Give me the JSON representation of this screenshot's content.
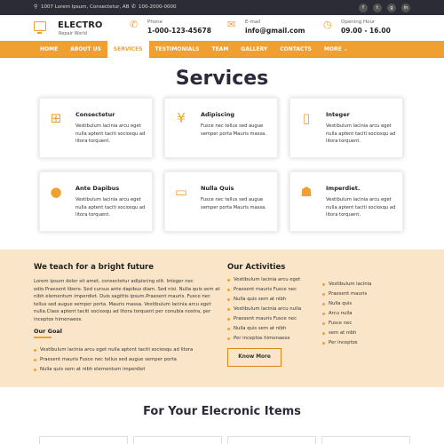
{
  "topbar": {
    "address": "1007 Lorem Ipsum, Consectetur, AB",
    "phone": "100-2000-0000",
    "socials": [
      "facebook-icon",
      "twitter-icon",
      "google-icon",
      "linkedin-icon"
    ]
  },
  "header": {
    "brand": "ELECTRO",
    "brand_sub": "Repair World",
    "phone_label": "Phone",
    "phone_value": "1-000-123-45678",
    "email_label": "E-mail",
    "email_value": "info@gmail.com",
    "hours_label": "Opening Hour",
    "hours_value": "09.00 - 16.00"
  },
  "nav": {
    "items": [
      "HOME",
      "ABOUT US",
      "SERVICES",
      "TESTIMONIALS",
      "TEAM",
      "GALLERY",
      "CONTACTS",
      "MORE ⌄"
    ],
    "active": "SERVICES"
  },
  "services": {
    "title": "Services",
    "cards": [
      {
        "icon": "windows-icon",
        "title": "Consectetur",
        "text": "Vestibulum lacinia arcu eget nulla aptent taciti sociosqu ad litora torquent."
      },
      {
        "icon": "yen-icon",
        "title": "Adipiscing",
        "text": "Fusce nec tellus sed augue semper porta Mauris massa."
      },
      {
        "icon": "mobile-icon",
        "title": "Integer",
        "text": "Vestibulum lacinia arcu eget nulla aptent taciti sociosqu ad litora torquent."
      },
      {
        "icon": "apple-icon",
        "title": "Ante Dapibus",
        "text": "Vestibulum lacinia arcu eget nulla aptent taciti sociosqu ad litora torquent."
      },
      {
        "icon": "tablet-icon",
        "title": "Nulla Quis",
        "text": "Fusce nec tellus sed augue semper porta Mauris massa."
      },
      {
        "icon": "android-icon",
        "title": "Imperdiet.",
        "text": "Vestibulum lacinia arcu eget nulla aptent taciti sociosqu ad litora torquent."
      }
    ]
  },
  "teach": {
    "title": "We teach for a bright future",
    "paragraph": "Lorem ipsum dolor sit amet, consectetur adipiscing elit. Integer nec odio.Praesent libero. Sed cursus ante dapibus diam. Sed nisi. Nulla quis sem at nibh elementum imperdiet. Duis sagittis ipsum.Praesent mauris. Fusce nec tellus sed augue semper porta. Mauris massa. Vestibulum lacinia arcu eget nulla.Class aptent taciti sociosqu ad litora torquent per conubia nostra, per inceptos himenaeos.",
    "goal_title": "Our Goal",
    "goals": [
      "Vestibulum lacinia arcu eget nulla aptent taciti sociosqu ad litora",
      "Praesent mauris Fusce nec tellus sed augue semper porta",
      "Nulla quis sem at nibh elementum imperdiet"
    ],
    "activities_title": "Our Activities",
    "activities_left": [
      "Vestibulum lacinia arcu eget",
      "Praesent mauris Fusce nec",
      "Nulla quis sem at nibh",
      "Vestibulum lacinia arcu nulla",
      "Praesent mauris Fusce nec",
      "Nulla quis sem at nibh",
      "Per inceptos himenaeos"
    ],
    "activities_right": [
      "Vestibulum lacinia",
      "Praesent mauris",
      "Nulla quis",
      "Arcu nulla",
      "Fusce nec",
      "sem at nibh",
      "Per inceptos"
    ],
    "button": "Know More"
  },
  "electronics": {
    "title": "For Your Elecronic Items"
  },
  "colors": {
    "accent": "#f0a030",
    "dark": "#2c2c36",
    "section_bg": "#fbe5c8"
  }
}
